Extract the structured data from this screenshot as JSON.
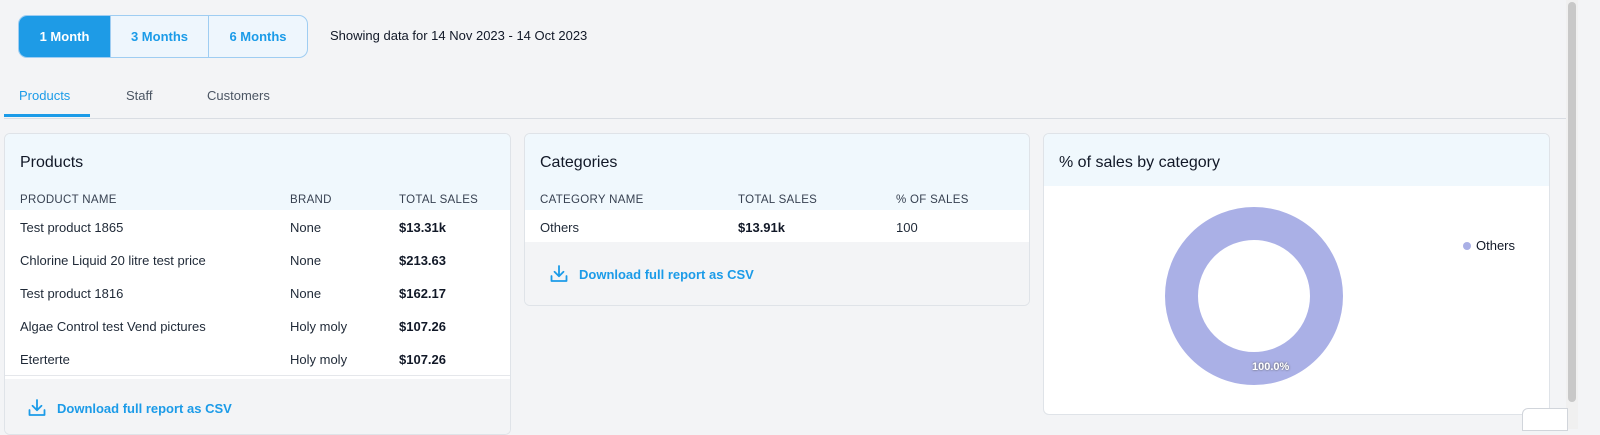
{
  "periods": [
    "1 Month",
    "3 Months",
    "6 Months"
  ],
  "active_period_index": 0,
  "range_text": "Showing data for 14 Nov 2023 - 14 Oct 2023",
  "tabs": [
    "Products",
    "Staff",
    "Customers"
  ],
  "active_tab_index": 0,
  "products": {
    "title": "Products",
    "columns": [
      "PRODUCT NAME",
      "BRAND",
      "TOTAL SALES"
    ],
    "rows": [
      {
        "name": "Test product 1865",
        "brand": "None",
        "sales": "$13.31k"
      },
      {
        "name": "Chlorine Liquid 20 litre test price",
        "brand": "None",
        "sales": "$213.63"
      },
      {
        "name": "Test product 1816",
        "brand": "None",
        "sales": "$162.17"
      },
      {
        "name": "Algae Control test Vend pictures",
        "brand": "Holy moly",
        "sales": "$107.26"
      },
      {
        "name": "Eterterte",
        "brand": "Holy moly",
        "sales": "$107.26"
      }
    ],
    "download_label": "Download full report as CSV"
  },
  "categories": {
    "title": "Categories",
    "columns": [
      "CATEGORY NAME",
      "TOTAL SALES",
      "% OF SALES"
    ],
    "rows": [
      {
        "name": "Others",
        "sales": "$13.91k",
        "percent": "100"
      }
    ],
    "download_label": "Download full report as CSV"
  },
  "sales_chart": {
    "title": "% of sales by category",
    "legend": [
      "Others"
    ],
    "slice_label": "100.0%",
    "color": "#aab0e6"
  },
  "colors": {
    "accent": "#1b9be8",
    "header_bg": "#f0f8fd",
    "donut": "#aab0e6"
  },
  "chart_data": {
    "type": "pie",
    "title": "% of sales by category",
    "categories": [
      "Others"
    ],
    "values": [
      100.0
    ],
    "legend": [
      "Others"
    ],
    "legend_position": "top-right",
    "donut": true
  }
}
